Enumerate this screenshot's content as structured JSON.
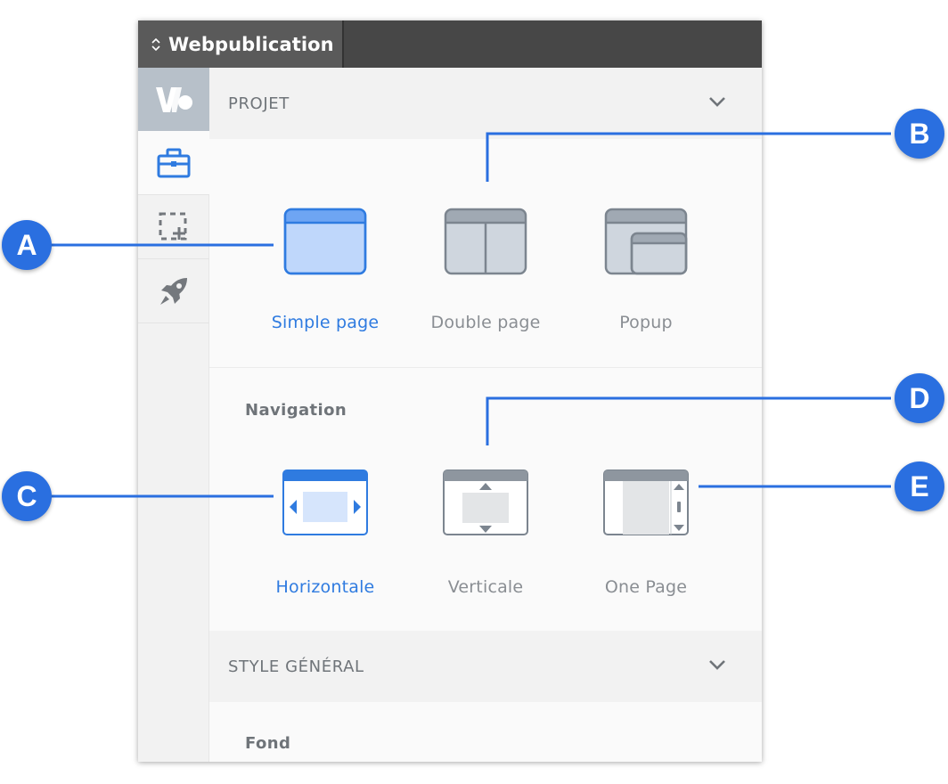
{
  "app": {
    "title": "Webpublication"
  },
  "colors": {
    "accent": "#2f7be0",
    "badge": "#2a6fe0",
    "topbar": "#474747",
    "muted": "#8a8e93"
  },
  "sidebar": {
    "items": [
      {
        "name": "logo",
        "icon": "webpublication-logo-icon"
      },
      {
        "name": "tools",
        "icon": "toolbox-icon"
      },
      {
        "name": "add",
        "icon": "add-selection-icon"
      },
      {
        "name": "publish",
        "icon": "rocket-icon"
      }
    ]
  },
  "sections": {
    "projet": {
      "title": "PROJET",
      "options": [
        {
          "label": "Simple page",
          "active": true
        },
        {
          "label": "Double page",
          "active": false
        },
        {
          "label": "Popup",
          "active": false
        }
      ]
    },
    "navigation": {
      "title": "Navigation",
      "options": [
        {
          "label": "Horizontale",
          "active": true
        },
        {
          "label": "Verticale",
          "active": false
        },
        {
          "label": "One Page",
          "active": false
        }
      ]
    },
    "style": {
      "title": "STYLE GÉNÉRAL"
    },
    "fond": {
      "title": "Fond"
    }
  },
  "annotations": {
    "a": "A",
    "b": "B",
    "c": "C",
    "d": "D",
    "e": "E"
  }
}
